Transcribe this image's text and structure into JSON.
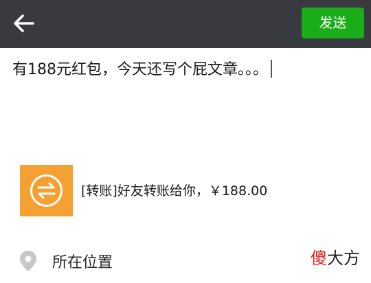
{
  "header": {
    "back_icon": "arrow-left-icon",
    "send_label": "发送",
    "colors": {
      "bar": "#393a3f",
      "send": "#1aad19"
    }
  },
  "compose": {
    "text": "有188元红包，今天还写个屁文章。。。"
  },
  "attachment": {
    "icon": "transfer-icon",
    "text": "[转账]好友转账给你，￥188.00",
    "color": "#f4a032"
  },
  "location": {
    "icon": "location-pin-icon",
    "label": "所在位置"
  },
  "watermark": {
    "part1": "傻",
    "part2": "大方"
  }
}
